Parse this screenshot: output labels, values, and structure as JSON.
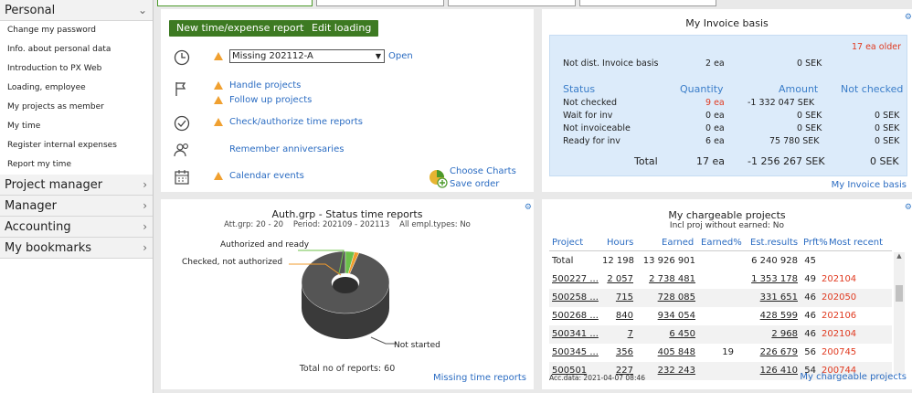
{
  "sidebar": {
    "sections": [
      {
        "label": "Personal",
        "expanded": true
      },
      {
        "label": "Project manager"
      },
      {
        "label": "Manager"
      },
      {
        "label": "Accounting"
      },
      {
        "label": "My bookmarks"
      }
    ],
    "personal_items": [
      "Change my password",
      "Info. about personal data",
      "Introduction to PX Web",
      "Loading, employee",
      "My projects as member",
      "My time",
      "Register internal expenses",
      "Report my time"
    ]
  },
  "actions": {
    "new_report": "New time/expense report",
    "edit_loading": "Edit loading",
    "missing_select": "Missing 202112-A",
    "open": "Open",
    "handle_projects": "Handle projects",
    "follow_up": "Follow up projects",
    "check_authorize": "Check/authorize time reports",
    "remember": "Remember anniversaries",
    "calendar": "Calendar events",
    "choose_charts": "Choose Charts",
    "save_order": "Save order"
  },
  "invoice": {
    "title": "My Invoice basis",
    "older": "17 ea older",
    "not_dist_label": "Not dist. Invoice basis",
    "not_dist_qty": "2 ea",
    "not_dist_amount": "0 SEK",
    "headers": [
      "Status",
      "Quantity",
      "Amount",
      "Not checked"
    ],
    "rows": [
      {
        "status": "Not checked",
        "qty": "9 ea",
        "amount": "-1 332 047 SEK",
        "nc": ""
      },
      {
        "status": "Wait for inv",
        "qty": "0 ea",
        "amount": "0 SEK",
        "nc": "0 SEK"
      },
      {
        "status": "Not invoiceable",
        "qty": "0 ea",
        "amount": "0 SEK",
        "nc": "0 SEK"
      },
      {
        "status": "Ready for inv",
        "qty": "6 ea",
        "amount": "75 780 SEK",
        "nc": "0 SEK"
      }
    ],
    "total": {
      "label": "Total",
      "qty": "17 ea",
      "amount": "-1 256 267 SEK",
      "nc": "0 SEK"
    },
    "footer_link": "My Invoice basis"
  },
  "auth_chart": {
    "title": "Auth.grp - Status time reports",
    "subtitle": "Att.grp: 20 - 20    Period: 202109 - 202113    All empl.types: No",
    "labels": [
      "Authorized and ready",
      "Checked, not authorized",
      "Not started"
    ],
    "total_text": "Total no of reports: 60",
    "footer_link": "Missing time reports"
  },
  "chart_data": {
    "type": "pie",
    "title": "Auth.grp - Status time reports",
    "categories": [
      "Not started",
      "Authorized and ready",
      "Checked, not authorized"
    ],
    "values": [
      57,
      2,
      1
    ],
    "total": 60,
    "colors": {
      "Not started": "#555555",
      "Authorized and ready": "#6cc04a",
      "Checked, not authorized": "#f29b2c"
    }
  },
  "projects": {
    "title": "My chargeable projects",
    "subtitle": "Incl proj without earned: No",
    "headers": [
      "Project",
      "Hours",
      "Earned",
      "Earned%",
      "Est.results",
      "Prft%",
      "Most recent"
    ],
    "total": {
      "project": "Total",
      "hours": "12 198",
      "earned": "13 926 901",
      "earned_pct": "",
      "est": "6 240 928",
      "prft": "45",
      "recent": ""
    },
    "rows": [
      {
        "project": "500227 ...",
        "hours": "2 057",
        "earned": "2 738 481",
        "earned_pct": "",
        "est": "1 353 178",
        "prft": "49",
        "recent": "202104"
      },
      {
        "project": "500258 ...",
        "hours": "715",
        "earned": "728 085",
        "earned_pct": "",
        "est": "331 651",
        "prft": "46",
        "recent": "202050"
      },
      {
        "project": "500268 ...",
        "hours": "840",
        "earned": "934 054",
        "earned_pct": "",
        "est": "428 599",
        "prft": "46",
        "recent": "202106"
      },
      {
        "project": "500341 ...",
        "hours": "7",
        "earned": "6 450",
        "earned_pct": "",
        "est": "2 968",
        "prft": "46",
        "recent": "202104"
      },
      {
        "project": "500345 ...",
        "hours": "356",
        "earned": "405 848",
        "earned_pct": "19",
        "est": "226 679",
        "prft": "56",
        "recent": "200745"
      },
      {
        "project": "500501",
        "hours": "227",
        "earned": "232 243",
        "earned_pct": "",
        "est": "126 410",
        "prft": "54",
        "recent": "200744"
      }
    ],
    "acc_data": "Acc.data: 2021-04-07 08:46",
    "footer_link": "My chargeable projects"
  },
  "colors": {
    "accent_green": "#3d7a22",
    "link_blue": "#2b6cc2",
    "alert_red": "#e03a20",
    "invoice_bg": "#dcebfa"
  }
}
